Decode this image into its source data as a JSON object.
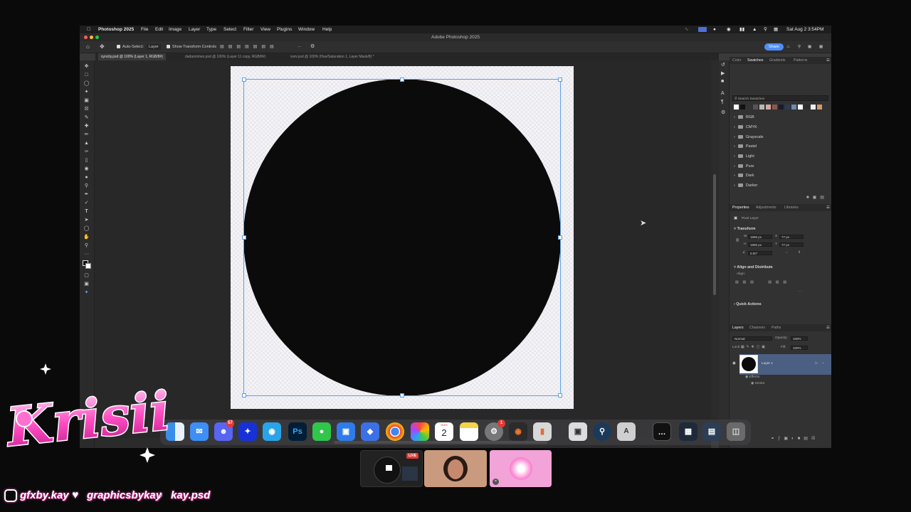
{
  "menubar": {
    "app": "Photoshop 2025",
    "items": [
      "File",
      "Edit",
      "Image",
      "Layer",
      "Type",
      "Select",
      "Filter",
      "View",
      "Plugins",
      "Window",
      "Help"
    ],
    "datetime": "Sat Aug 2  3:54PM"
  },
  "titlebar": {
    "title": "Adobe Photoshop 2025"
  },
  "options": {
    "auto_select_label": "Auto-Select:",
    "auto_select_value": "Layer",
    "transform_label": "Show Transform Controls",
    "share_label": "Share"
  },
  "doc_tabs": [
    "syncity.psd @ 100% (Layer 1, RGB/8#)",
    "dadasmmes.psd @ 100% (Layer 11 copy, RGB/8#)",
    "svm.psd @ 100% (Hue/Saturation 1, Layer Mask/8) *"
  ],
  "swatches_panel": {
    "tabs": [
      "Color",
      "Swatches",
      "Gradients",
      "Patterns"
    ],
    "active_tab": "Swatches",
    "search_placeholder": "Search Swatches",
    "swatch_colors": [
      "#ffffff",
      "#111111",
      "#333333",
      "#555555",
      "#b8b8b8",
      "#d9a6a6",
      "#8a5a4a",
      "#1a1a2e",
      "#2a3a5a",
      "#6a8ab0",
      "#ffffff",
      "#2d2d2d",
      "#eeeeee",
      "#d49a6a"
    ],
    "folders": [
      "RGB",
      "CMYK",
      "Grayscale",
      "Pastel",
      "Light",
      "Pure",
      "Dark",
      "Darker"
    ]
  },
  "properties_panel": {
    "tabs": [
      "Properties",
      "Adjustments",
      "Libraries"
    ],
    "active_tab": "Properties",
    "layer_type": "Pixel Layer",
    "transform_title": "Transform",
    "w_label": "W",
    "w_value": "1895 px",
    "h_label": "H",
    "h_value": "1895 px",
    "x_label": "X",
    "x_value": "77 px",
    "y_label": "Y",
    "y_value": "77 px",
    "angle_value": "0.00°",
    "align_title": "Align and Distribute",
    "align_label": "Align:",
    "quick_actions_title": "Quick Actions"
  },
  "layers_panel": {
    "tabs": [
      "Layers",
      "Channels",
      "Paths"
    ],
    "active_tab": "Layers",
    "blend_mode": "Normal",
    "opacity_label": "Opacity:",
    "opacity_value": "100%",
    "lock_label": "Lock:",
    "fill_label": "Fill:",
    "fill_value": "100%",
    "layer_name": "Layer 1",
    "effects_label": "Effects",
    "stroke_label": "Stroke",
    "fx_label": "fx"
  },
  "dock": {
    "apps": [
      "finder",
      "mail",
      "discord",
      "game-app",
      "game-app-2",
      "photoshop",
      "messages",
      "app",
      "app",
      "chrome",
      "photos",
      "calendar",
      "notes",
      "system-settings",
      "blender",
      "app",
      "app",
      "quicktime",
      "font-book",
      "terminal",
      "app",
      "app",
      "trash"
    ],
    "discord_badge": "57",
    "settings_badge": "1",
    "calendar_month": "AUG",
    "calendar_day": "2",
    "photoshop_label": "Ps"
  },
  "overlay": {
    "logo_text": "Krisii",
    "live_label": "LIVE",
    "socials": [
      "gfxby.kay",
      "graphicsbykay",
      "kay.psd"
    ]
  },
  "colors": {
    "accent": "#4f8ff7",
    "selection": "#5aa0e6",
    "logo_pink": "#ff4fc3"
  }
}
